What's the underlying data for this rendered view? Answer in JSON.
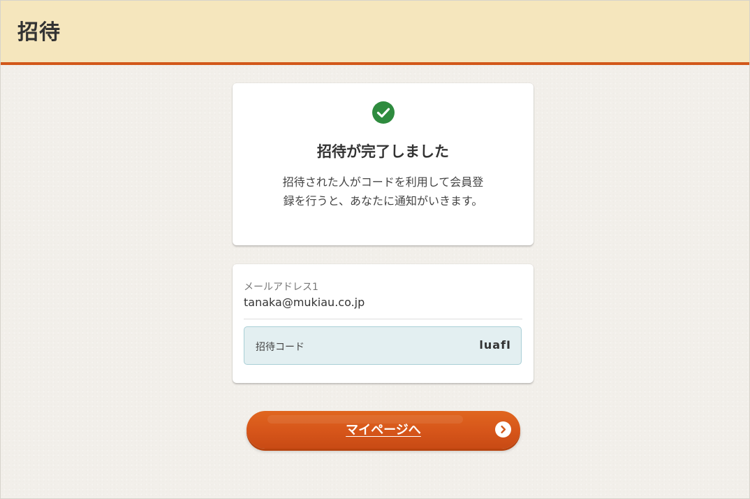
{
  "header": {
    "title": "招待"
  },
  "complete_card": {
    "icon": "check-circle-icon",
    "title": "招待が完了しました",
    "message": "招待された人がコードを利用して会員登録を行うと、あなたに通知がいきます。"
  },
  "invite_card": {
    "email_label": "メールアドレス1",
    "email_value": "tanaka@mukiau.co.jp",
    "code_label": "招待コード",
    "code_value": "luafI"
  },
  "mypage_button": {
    "label": "マイページへ",
    "icon": "chevron-right-circle-icon"
  },
  "colors": {
    "header_bg": "#f5e6bd",
    "accent": "#d2581a",
    "success": "#2e8b3e",
    "code_bg": "#e3eff1",
    "page_bg": "#f2efea"
  }
}
